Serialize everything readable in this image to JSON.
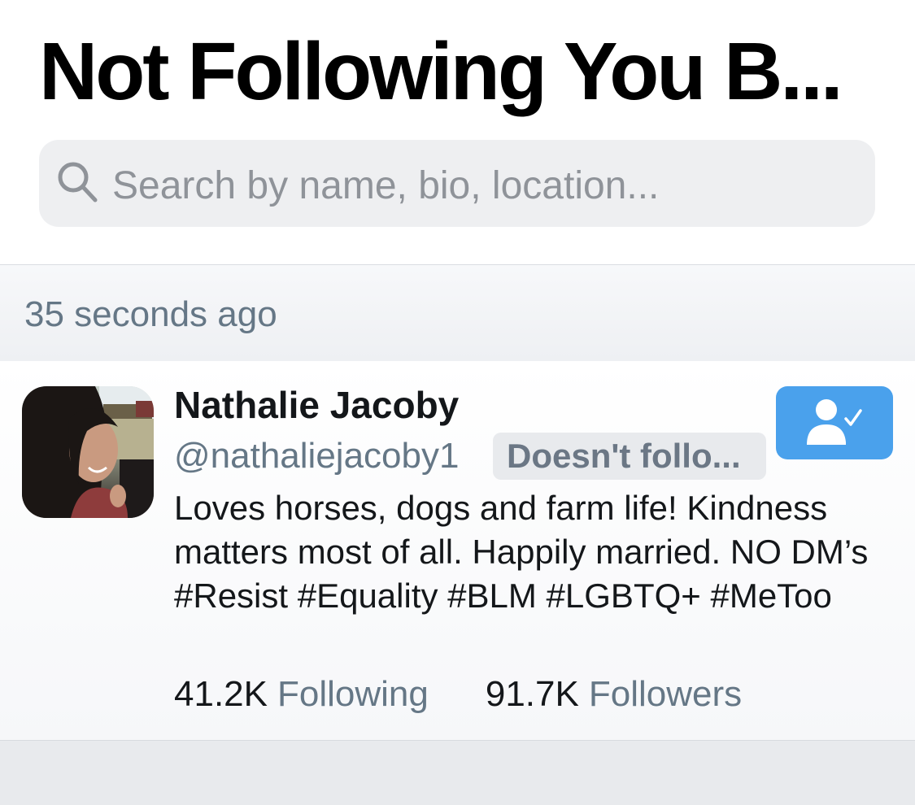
{
  "header": {
    "title": "Not Following You B..."
  },
  "search": {
    "icon": "search-icon",
    "placeholder": "Search by name, bio, location..."
  },
  "section": {
    "timestamp": "35 seconds ago"
  },
  "user": {
    "name": "Nathalie Jacoby",
    "handle": "@nathaliejacoby1",
    "badge": "Doesn't follo...",
    "bio": "Loves horses, dogs and farm life! Kindness matters most of all. Happily married. NO DM’s #Resist #Equality #BLM #LGBTQ+ #MeToo",
    "stats": {
      "following_count": "41.2K",
      "following_label": "Following",
      "followers_count": "91.7K",
      "followers_label": "Followers"
    },
    "follow_button_icon": "user-check-icon",
    "avatar": "profile-photo"
  },
  "colors": {
    "accent": "#4aa1ec",
    "secondary_text": "#657786",
    "search_bg": "#eeeff1"
  }
}
